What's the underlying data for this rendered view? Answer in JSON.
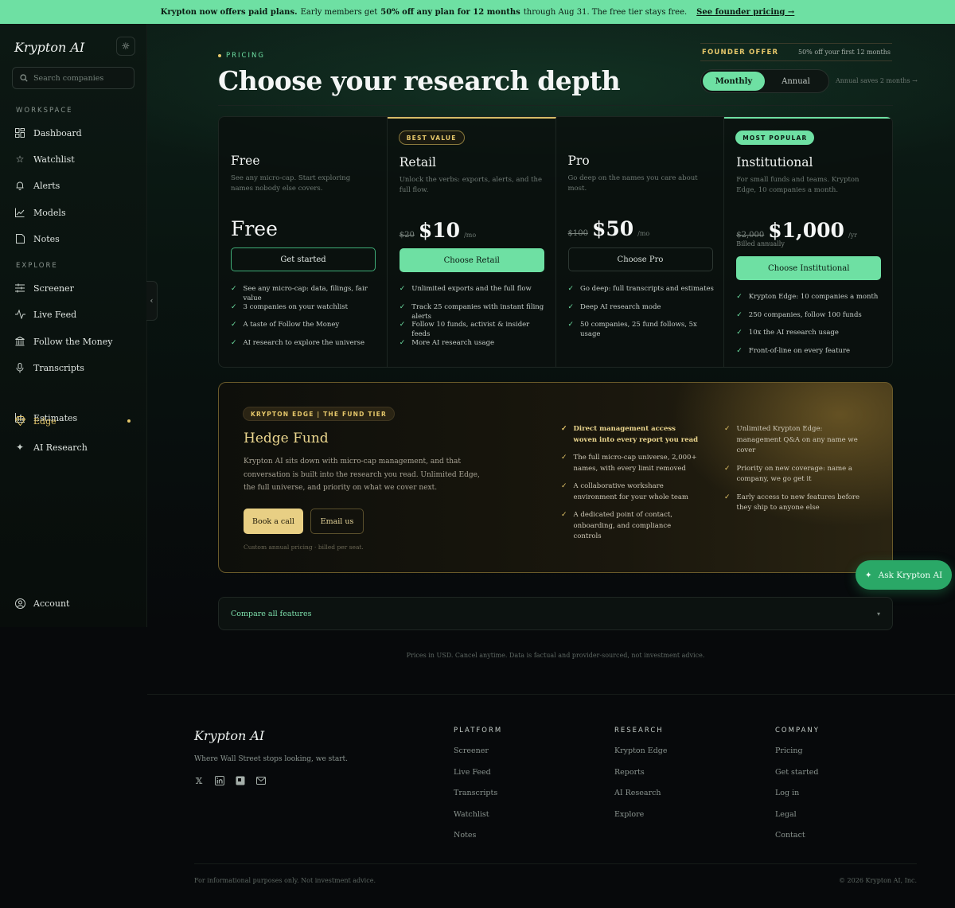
{
  "banner": {
    "bold1": "Krypton now offers paid plans.",
    "text1": "Early members get",
    "bold2": "50% off any plan for 12 months",
    "text2": "through Aug 31. The free tier stays free.",
    "link": "See founder pricing →"
  },
  "sidebar": {
    "logo": "Krypton AI",
    "search_placeholder": "Search companies",
    "workspace_label": "WORKSPACE",
    "explore_label": "EXPLORE",
    "workspace": [
      {
        "label": "Dashboard",
        "icon": "dashboard-icon"
      },
      {
        "label": "Watchlist",
        "icon": "star-icon"
      },
      {
        "label": "Alerts",
        "icon": "bell-icon"
      },
      {
        "label": "Models",
        "icon": "chart-line-icon"
      },
      {
        "label": "Notes",
        "icon": "note-icon"
      }
    ],
    "explore": [
      {
        "label": "Screener",
        "icon": "sliders-icon"
      },
      {
        "label": "Live Feed",
        "icon": "pulse-icon"
      },
      {
        "label": "Follow the Money",
        "icon": "bank-icon"
      },
      {
        "label": "Transcripts",
        "icon": "mic-icon"
      },
      {
        "label": "Estimates",
        "icon": "bar-chart-icon"
      },
      {
        "label": "Edge",
        "icon": "diamond-icon"
      },
      {
        "label": "AI Research",
        "icon": "sparkle-icon"
      }
    ],
    "account": "Account"
  },
  "header": {
    "eyebrow": "PRICING",
    "title": "Choose your research depth",
    "founder_label": "FOUNDER OFFER",
    "founder_detail": "50% off your first 12 months",
    "monthly": "Monthly",
    "annual": "Annual",
    "annual_note": "Annual saves 2 months →"
  },
  "plans": [
    {
      "name": "Free",
      "desc": "See any micro-cap. Start exploring names nobody else covers.",
      "price": "Free",
      "cta": "Get started",
      "features": [
        "See any micro-cap: data, filings, fair value",
        "3 companies on your watchlist",
        "A taste of Follow the Money",
        "AI research to explore the universe"
      ]
    },
    {
      "badge": "BEST VALUE",
      "name": "Retail",
      "desc": "Unlock the verbs: exports, alerts, and the full flow.",
      "old_price": "$20",
      "price": "$10",
      "per": "/mo",
      "cta": "Choose Retail",
      "features": [
        "Unlimited exports and the full flow",
        "Track 25 companies with instant filing alerts",
        "Follow 10 funds, activist & insider feeds",
        "More AI research usage"
      ]
    },
    {
      "name": "Pro",
      "desc": "Go deep on the names you care about most.",
      "old_price": "$100",
      "price": "$50",
      "per": "/mo",
      "cta": "Choose Pro",
      "features": [
        "Go deep: full transcripts and estimates",
        "Deep AI research mode",
        "50 companies, 25 fund follows, 5x usage"
      ]
    },
    {
      "badge": "MOST POPULAR",
      "name": "Institutional",
      "desc": "For small funds and teams. Krypton Edge, 10 companies a month.",
      "old_price": "$2,000",
      "price": "$1,000",
      "per": "/yr",
      "billed": "Billed annually",
      "cta": "Choose Institutional",
      "features": [
        "Krypton Edge: 10 companies a month",
        "250 companies, follow 100 funds",
        "10x the AI research usage",
        "Front-of-line on every feature"
      ]
    }
  ],
  "hedge": {
    "badge": "KRYPTON EDGE | THE FUND TIER",
    "title": "Hedge Fund",
    "desc": "Krypton AI sits down with micro-cap management, and that conversation is built into the research you read. Unlimited Edge, the full universe, and priority on what we cover next.",
    "book": "Book a call",
    "email": "Email us",
    "note": "Custom annual pricing · billed per seat.",
    "features_left": [
      "Direct management access woven into every report you read",
      "The full micro-cap universe, 2,000+ names, with every limit removed",
      "A collaborative workshare environment for your whole team",
      "A dedicated point of contact, onboarding, and compliance controls"
    ],
    "features_right": [
      "Unlimited Krypton Edge: management Q&A on any name we cover",
      "Priority on new coverage: name a company, we go get it",
      "Early access to new features before they ship to anyone else"
    ]
  },
  "ask": "Ask Krypton AI",
  "compare": "Compare all features",
  "disclaimer": "Prices in USD. Cancel anytime. Data is factual and provider-sourced, not investment advice.",
  "footer": {
    "logo": "Krypton AI",
    "tagline": "Where Wall Street stops looking, we start.",
    "platform_label": "PLATFORM",
    "platform": [
      "Screener",
      "Live Feed",
      "Transcripts",
      "Watchlist",
      "Notes"
    ],
    "research_label": "RESEARCH",
    "research": [
      "Krypton Edge",
      "Reports",
      "AI Research",
      "Explore"
    ],
    "company_label": "COMPANY",
    "company": [
      "Pricing",
      "Get started",
      "Log in",
      "Legal",
      "Contact"
    ],
    "legal": "For informational purposes only. Not investment advice.",
    "copyright": "© 2026 Krypton AI, Inc."
  }
}
